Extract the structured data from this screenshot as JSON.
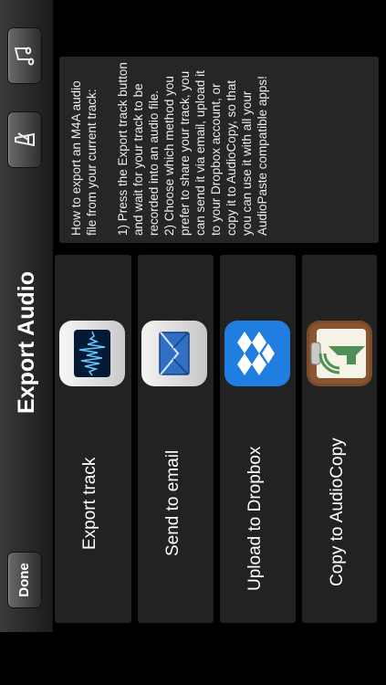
{
  "nav": {
    "title": "Export Audio",
    "done_label": "Done"
  },
  "actions": [
    {
      "label": "Export track",
      "icon": "waveform-icon"
    },
    {
      "label": "Send to email",
      "icon": "envelope-icon"
    },
    {
      "label": "Upload to Dropbox",
      "icon": "dropbox-icon"
    },
    {
      "label": "Copy to AudioCopy",
      "icon": "audiocopy-icon"
    }
  ],
  "info": {
    "text": "How to export an M4A audio file from your current track:\n\n1) Press the Export track button and wait for your track to be recorded into an audio file.\n2) Choose which method you prefer to share your track, you can send it via email, upload it to your Dropbox account, or copy it to AudioCopy, so that you can use it with all your AudioPaste compatible apps!"
  },
  "colors": {
    "dropbox_blue": "#1f7ee0",
    "audiocopy_green": "#4f8f55",
    "card_bg": "#222222"
  }
}
